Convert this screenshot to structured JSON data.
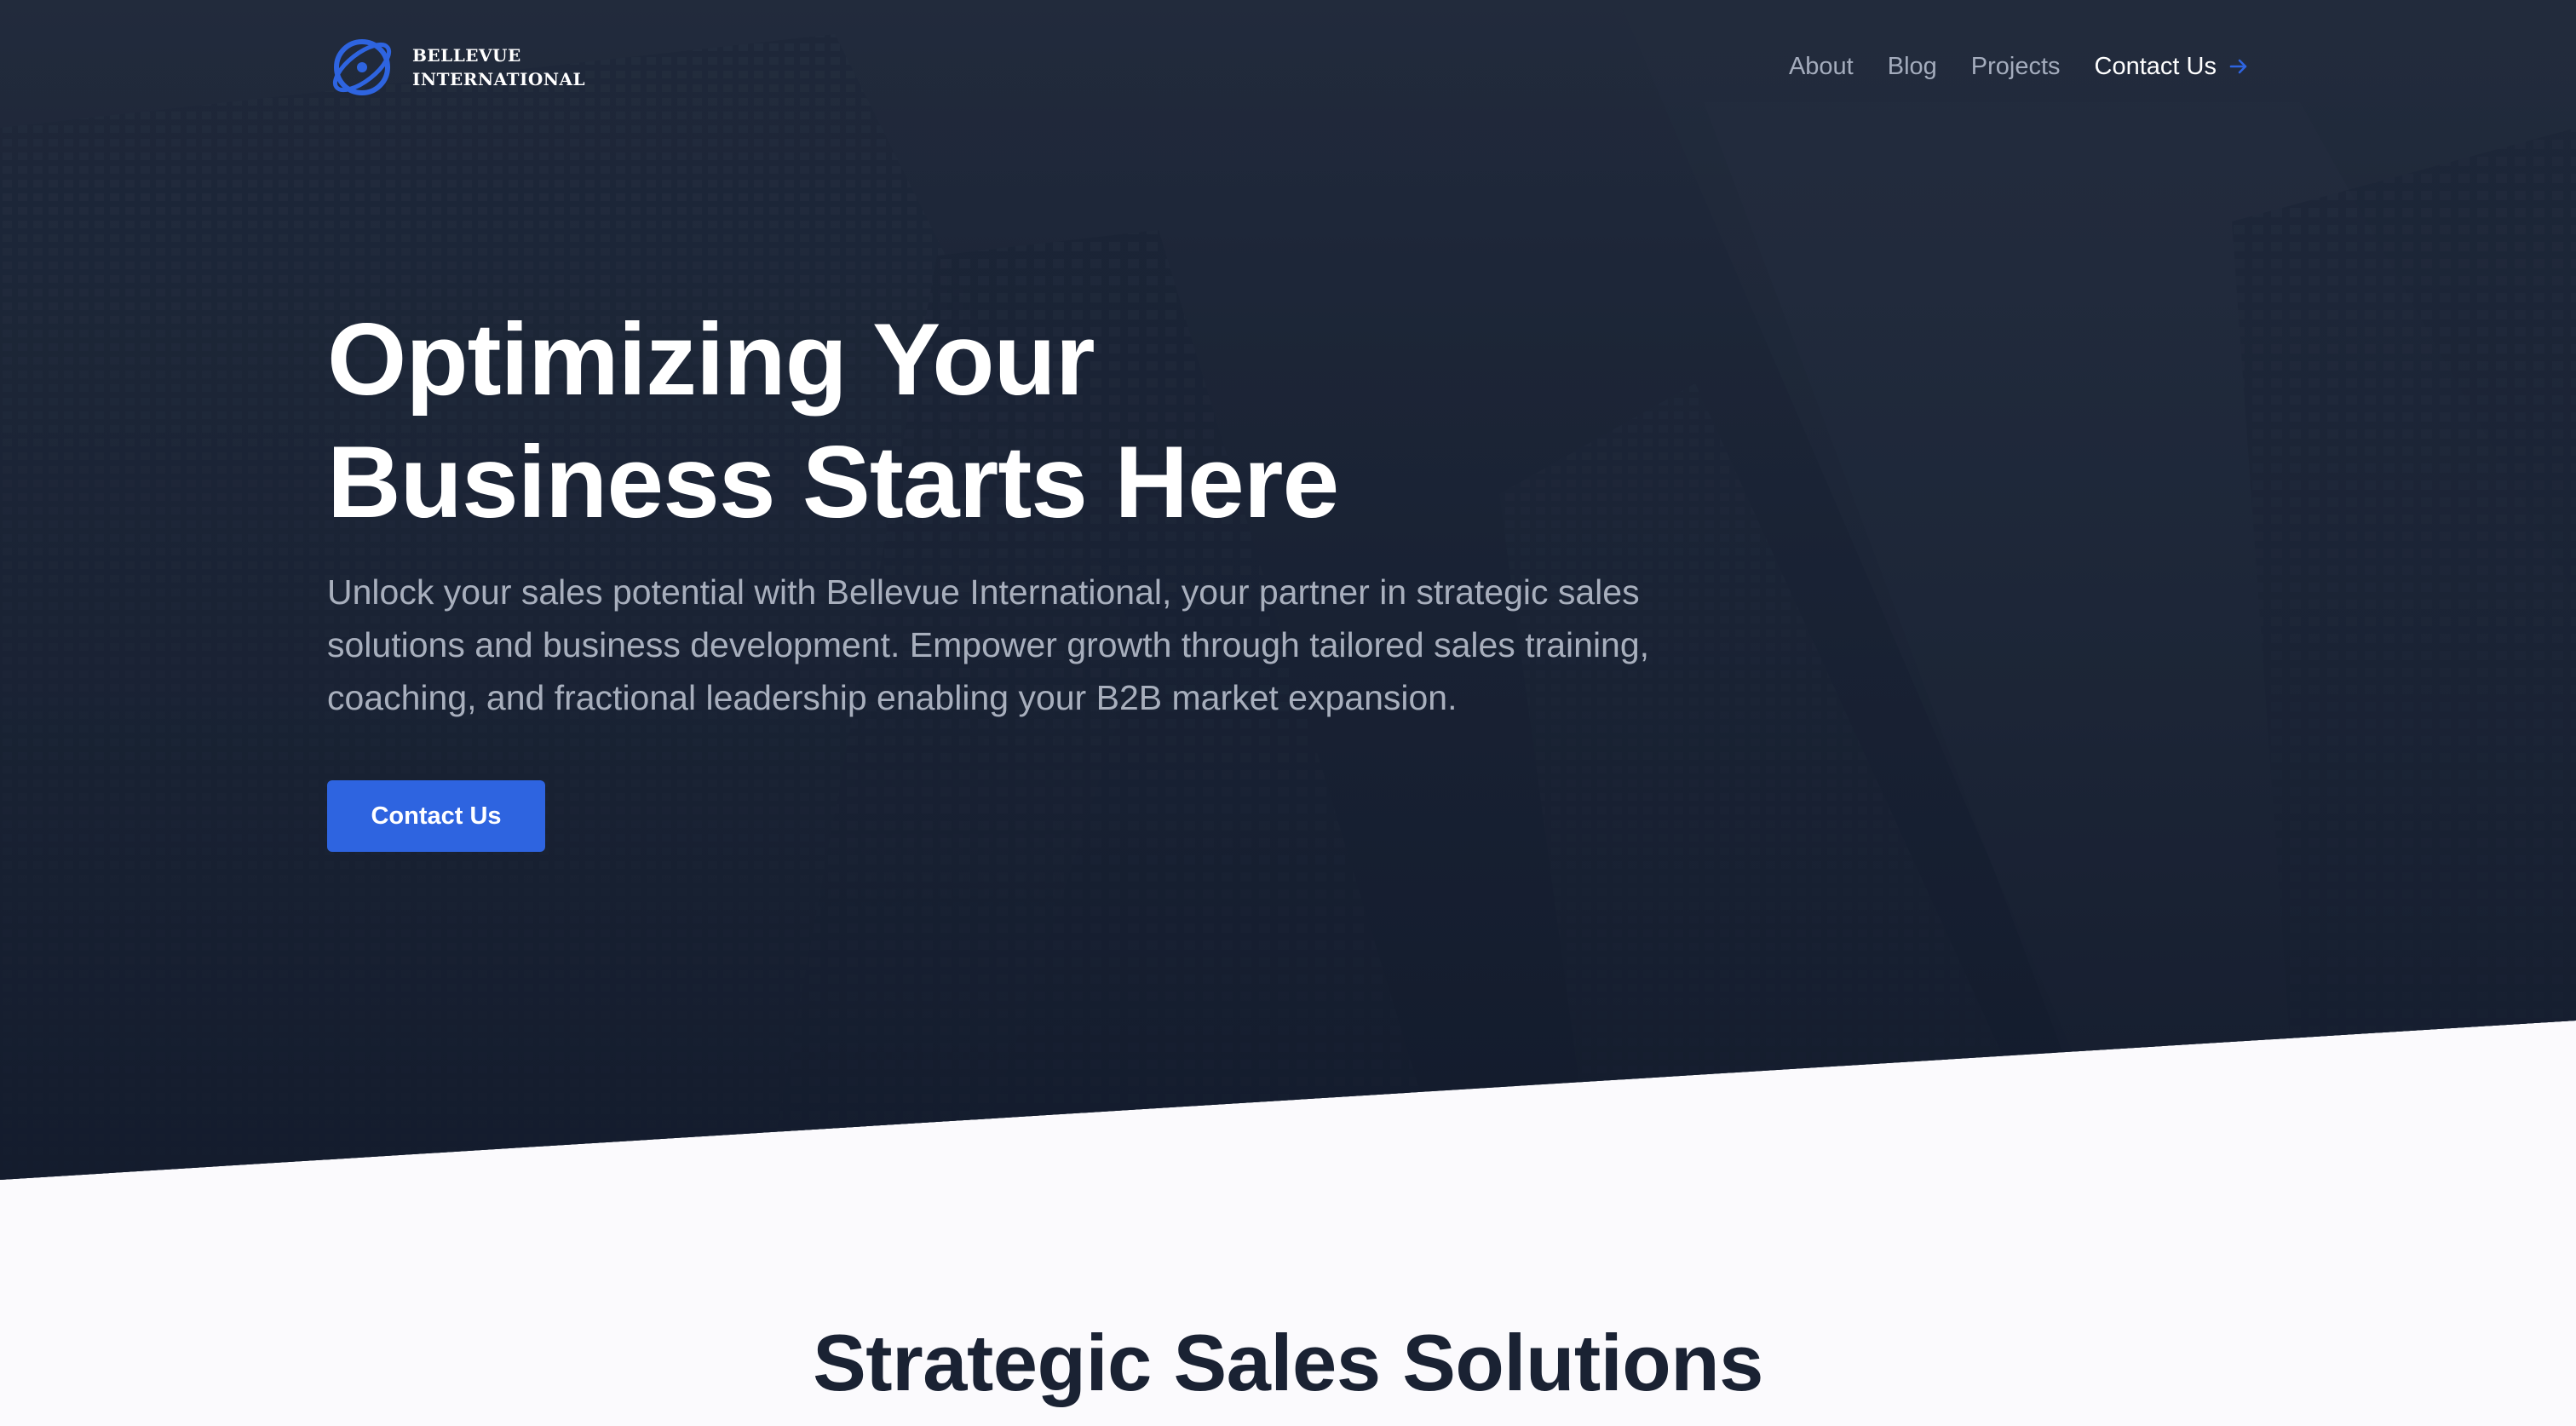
{
  "brand": {
    "line1": "BELLEVUE",
    "line2": "INTERNATIONAL",
    "logo_icon": "globe-orbit-logo-icon",
    "accent_color": "#2e64e0"
  },
  "nav": {
    "items": [
      {
        "label": "About"
      },
      {
        "label": "Blog"
      },
      {
        "label": "Projects"
      }
    ],
    "contact_label": "Contact Us",
    "contact_icon": "arrow-right-icon"
  },
  "hero": {
    "title_line1": "Optimizing Your",
    "title_line2": "Business Starts Here",
    "subtitle": "Unlock your sales potential with Bellevue International, your partner in strategic sales solutions and business development. Empower growth through tailored sales training, coaching, and fractional leadership enabling your B2B market expansion.",
    "cta_label": "Contact Us",
    "background_color": "#1f2839"
  },
  "section": {
    "title": "Strategic Sales Solutions"
  }
}
